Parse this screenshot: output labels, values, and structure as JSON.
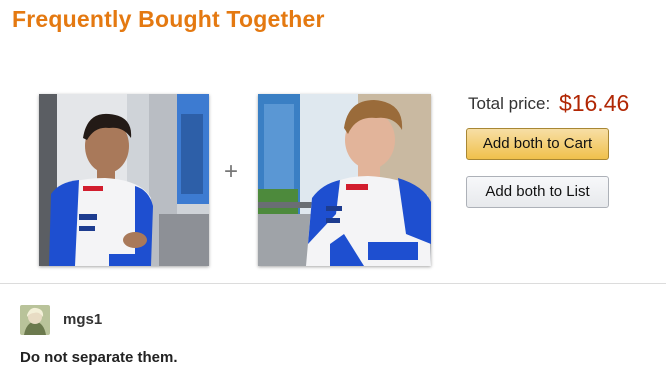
{
  "widget": {
    "title": "Frequently Bought Together",
    "plus_sign": "+",
    "total_label": "Total price:",
    "total_price": "$16.46",
    "add_cart_label": "Add both to Cart",
    "add_list_label": "Add both to List",
    "products": [
      {
        "name": "product-image-1",
        "accent": "#1e4fd0"
      },
      {
        "name": "product-image-2",
        "accent": "#1e4fd0"
      }
    ]
  },
  "comment": {
    "username": "mgs1",
    "text": "Do not separate them."
  },
  "colors": {
    "title": "#e47911",
    "price": "#b12704",
    "cart_button": "#f0c14b",
    "list_button": "#e7e9ec"
  }
}
